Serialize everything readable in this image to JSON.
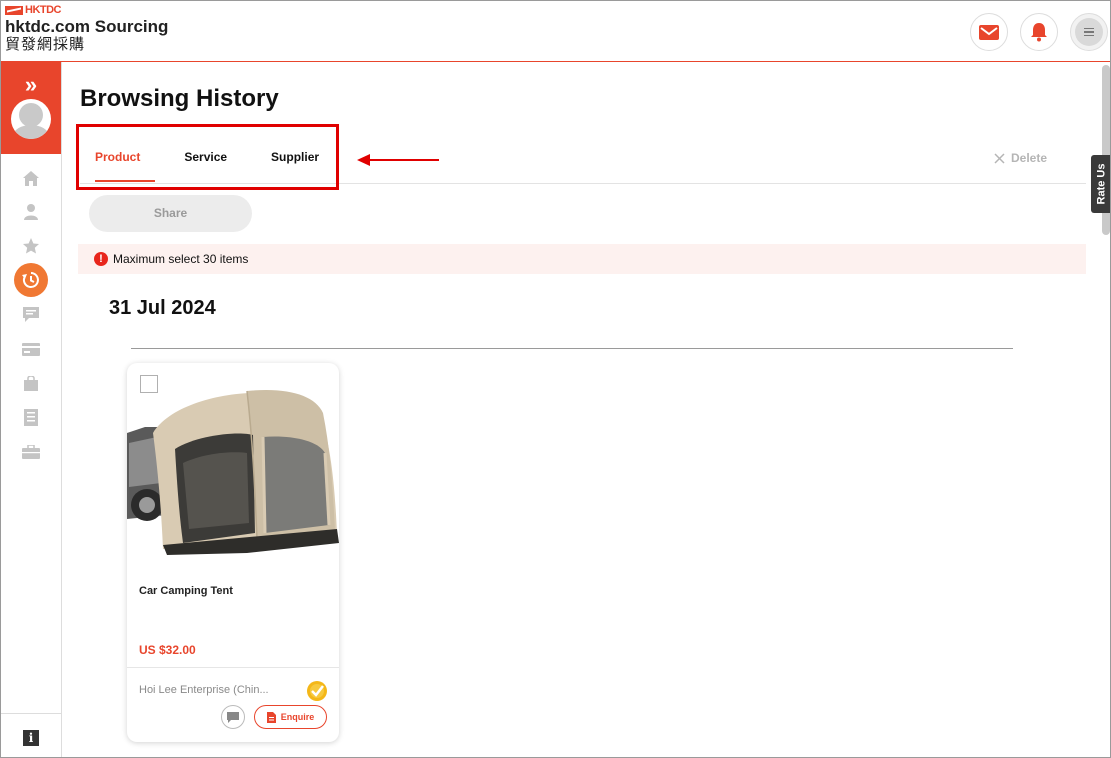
{
  "header": {
    "logo_mark": "HKTDC",
    "logo_title": "hktdc.com Sourcing",
    "logo_cn": "貿發網採購",
    "mail_icon": "mail-icon",
    "bell_icon": "bell-icon",
    "menu_icon": "hamburger-menu-icon",
    "accent_color": "#e8452c"
  },
  "sidebar": {
    "expand_icon": "double-chevron-right-icon",
    "items": [
      {
        "icon": "home-icon"
      },
      {
        "icon": "user-icon"
      },
      {
        "icon": "star-icon"
      },
      {
        "icon": "history-icon",
        "active": true
      },
      {
        "icon": "message-icon"
      },
      {
        "icon": "card-icon"
      },
      {
        "icon": "shopping-bag-icon"
      },
      {
        "icon": "document-list-icon"
      },
      {
        "icon": "briefcase-icon"
      }
    ],
    "info_label": "i"
  },
  "main": {
    "title": "Browsing History",
    "tabs": [
      {
        "label": "Product",
        "active": true
      },
      {
        "label": "Service",
        "active": false
      },
      {
        "label": "Supplier",
        "active": false
      }
    ],
    "delete_label": "Delete",
    "share_label": "Share",
    "notice": {
      "icon_label": "!",
      "text": "Maximum select 30 items"
    },
    "date_heading": "31 Jul 2024",
    "products": [
      {
        "name": "Car Camping Tent",
        "price": "US $32.00",
        "supplier": "Hoi Lee Enterprise (Chin...",
        "enquire_label": "Enquire",
        "selected": false
      }
    ]
  },
  "rate_us": "Rate Us"
}
